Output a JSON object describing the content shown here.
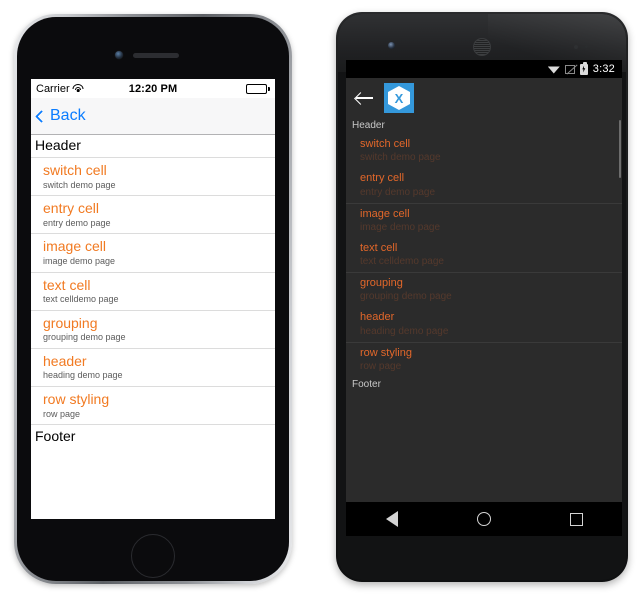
{
  "ios": {
    "status": {
      "carrier": "Carrier",
      "wifi_icon": "wifi-icon",
      "time": "12:20 PM",
      "battery_icon": "battery-full-icon"
    },
    "nav": {
      "back_label": "Back",
      "back_icon": "chevron-left-icon"
    },
    "list": {
      "header": "Header",
      "footer": "Footer",
      "rows": [
        {
          "title": "switch cell",
          "detail": "switch demo page"
        },
        {
          "title": "entry cell",
          "detail": "entry demo page"
        },
        {
          "title": "image cell",
          "detail": "image demo page"
        },
        {
          "title": "text cell",
          "detail": "text celldemo page"
        },
        {
          "title": "grouping",
          "detail": "grouping demo page"
        },
        {
          "title": "header",
          "detail": "heading demo page"
        },
        {
          "title": "row styling",
          "detail": "row page"
        }
      ]
    },
    "hardware": {
      "camera_icon": "front-camera-icon",
      "speaker_icon": "earpiece-speaker-icon",
      "home_button": "home-button"
    }
  },
  "android": {
    "status": {
      "wifi_icon": "wifi-icon",
      "signal_icon": "no-signal-icon",
      "battery_icon": "battery-charging-icon",
      "time": "3:32"
    },
    "toolbar": {
      "back_icon": "back-arrow-icon",
      "logo": "xamarin-logo-icon",
      "logo_letter": "X"
    },
    "list": {
      "header": "Header",
      "footer": "Footer",
      "rows": [
        {
          "title": "switch cell",
          "detail": "switch demo page"
        },
        {
          "title": "entry cell",
          "detail": "entry demo page"
        },
        {
          "title": "image cell",
          "detail": "image demo page"
        },
        {
          "title": "text cell",
          "detail": "text celldemo page"
        },
        {
          "title": "grouping",
          "detail": "grouping demo page"
        },
        {
          "title": "header",
          "detail": "heading demo page"
        },
        {
          "title": "row styling",
          "detail": "row page"
        }
      ]
    },
    "navbar": {
      "back_icon": "nav-back-icon",
      "home_icon": "nav-home-icon",
      "recents_icon": "nav-recents-icon"
    },
    "hardware": {
      "camera_icon": "front-camera-icon",
      "speaker_icon": "earpiece-speaker-icon"
    }
  },
  "colors": {
    "ios_accent_orange": "#f17a22",
    "ios_link_blue": "#0a7cff",
    "android_accent_orange": "#e2672a",
    "android_detail_dim": "#55392c",
    "android_surface": "#2b2b2b",
    "xamarin_blue": "#3498db"
  }
}
